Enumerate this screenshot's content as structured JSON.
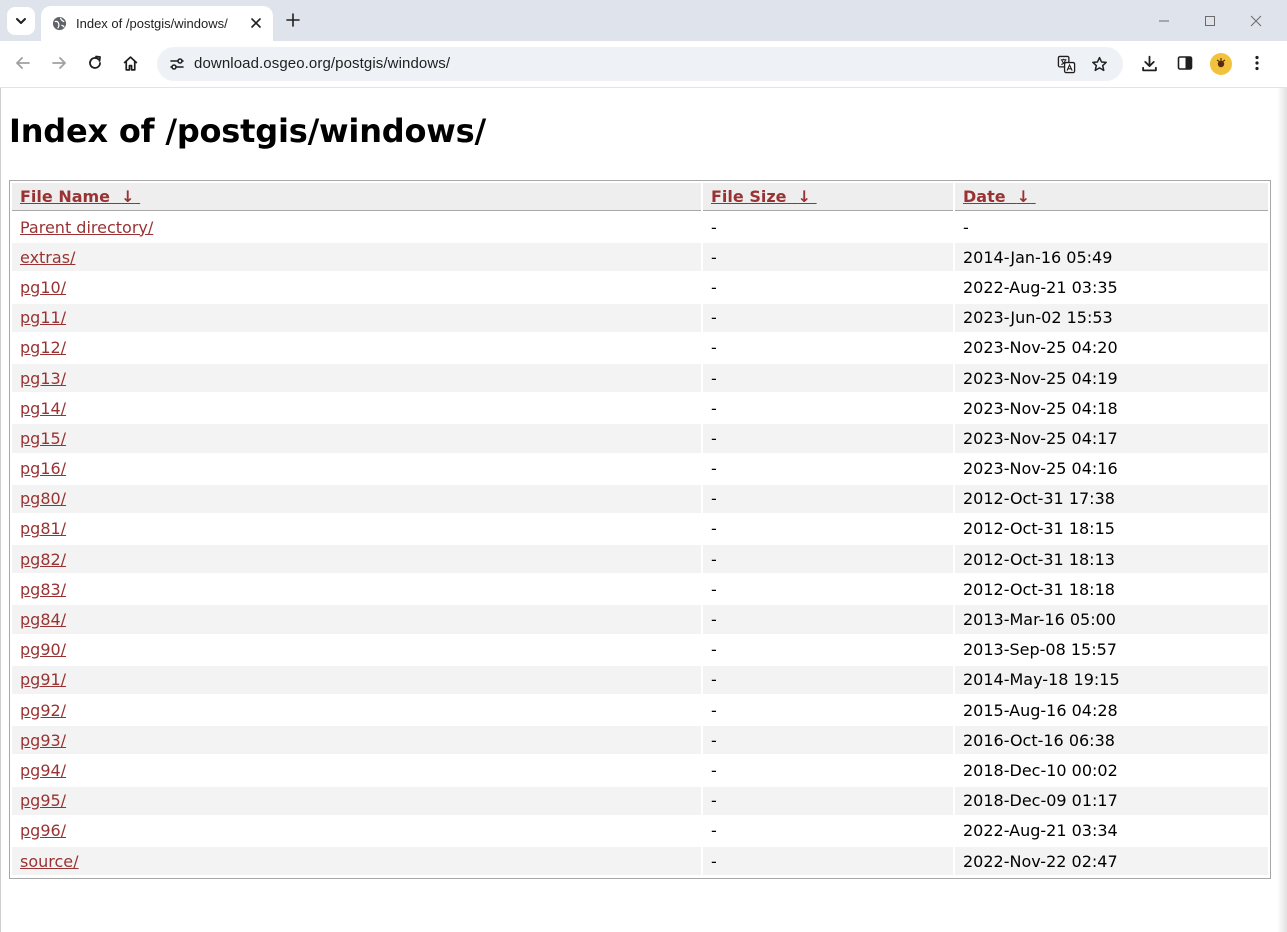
{
  "browser": {
    "tab_title": "Index of /postgis/windows/",
    "url": "download.osgeo.org/postgis/windows/",
    "icons": {
      "tab_list": "chevron-down-icon",
      "favicon": "globe-icon",
      "tab_close": "close-icon",
      "new_tab": "plus-icon",
      "back": "back-arrow-icon",
      "forward": "forward-arrow-icon",
      "reload": "reload-icon",
      "home": "home-icon",
      "site_info": "tune-icon",
      "translate": "translate-icon",
      "bookmark": "star-icon",
      "downloads": "download-icon",
      "side_panel": "side-panel-icon",
      "menu": "kebab-menu-icon"
    }
  },
  "page": {
    "heading": "Index of /postgis/windows/",
    "columns": {
      "name": "File Name",
      "size": "File Size",
      "date": "Date",
      "sort_arrow": "↓"
    },
    "rows": [
      {
        "name": "Parent directory/",
        "size": "-",
        "date": "-"
      },
      {
        "name": "extras/",
        "size": "-",
        "date": "2014-Jan-16 05:49"
      },
      {
        "name": "pg10/",
        "size": "-",
        "date": "2022-Aug-21 03:35"
      },
      {
        "name": "pg11/",
        "size": "-",
        "date": "2023-Jun-02 15:53"
      },
      {
        "name": "pg12/",
        "size": "-",
        "date": "2023-Nov-25 04:20"
      },
      {
        "name": "pg13/",
        "size": "-",
        "date": "2023-Nov-25 04:19"
      },
      {
        "name": "pg14/",
        "size": "-",
        "date": "2023-Nov-25 04:18"
      },
      {
        "name": "pg15/",
        "size": "-",
        "date": "2023-Nov-25 04:17"
      },
      {
        "name": "pg16/",
        "size": "-",
        "date": "2023-Nov-25 04:16"
      },
      {
        "name": "pg80/",
        "size": "-",
        "date": "2012-Oct-31 17:38"
      },
      {
        "name": "pg81/",
        "size": "-",
        "date": "2012-Oct-31 18:15"
      },
      {
        "name": "pg82/",
        "size": "-",
        "date": "2012-Oct-31 18:13"
      },
      {
        "name": "pg83/",
        "size": "-",
        "date": "2012-Oct-31 18:18"
      },
      {
        "name": "pg84/",
        "size": "-",
        "date": "2013-Mar-16 05:00"
      },
      {
        "name": "pg90/",
        "size": "-",
        "date": "2013-Sep-08 15:57"
      },
      {
        "name": "pg91/",
        "size": "-",
        "date": "2014-May-18 19:15"
      },
      {
        "name": "pg92/",
        "size": "-",
        "date": "2015-Aug-16 04:28"
      },
      {
        "name": "pg93/",
        "size": "-",
        "date": "2016-Oct-16 06:38"
      },
      {
        "name": "pg94/",
        "size": "-",
        "date": "2018-Dec-10 00:02"
      },
      {
        "name": "pg95/",
        "size": "-",
        "date": "2018-Dec-09 01:17"
      },
      {
        "name": "pg96/",
        "size": "-",
        "date": "2022-Aug-21 03:34"
      },
      {
        "name": "source/",
        "size": "-",
        "date": "2022-Nov-22 02:47"
      }
    ]
  },
  "colors": {
    "link": "#993333",
    "header_bg": "#eeeeee",
    "stripe_bg": "#f3f3f3",
    "chrome_bg": "#dfe3eb",
    "omnibox_bg": "#eef1f6"
  }
}
